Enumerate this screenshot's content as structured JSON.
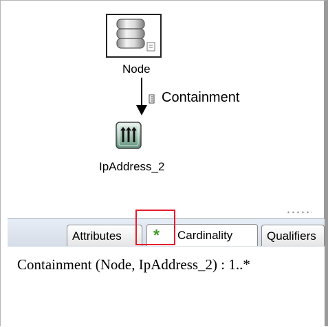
{
  "diagram": {
    "nodes": [
      {
        "label": "Node",
        "icon": "database-icon"
      },
      {
        "label": "IpAddress_2",
        "icon": "ip-address-icon"
      }
    ],
    "edge": {
      "label": "Containment",
      "icon": "relationship-icon"
    }
  },
  "tabs": [
    {
      "label": "Attributes"
    },
    {
      "label": "Cardinality",
      "icon": "asterisk-icon"
    },
    {
      "label": "Qualifiers"
    }
  ],
  "content": {
    "text": "Containment (Node, IpAddress_2) : 1..*"
  },
  "colors": {
    "highlight": "#e71a2a",
    "active_tab_icon": "#3b9b25",
    "tab_strip": "#dce3ee"
  }
}
